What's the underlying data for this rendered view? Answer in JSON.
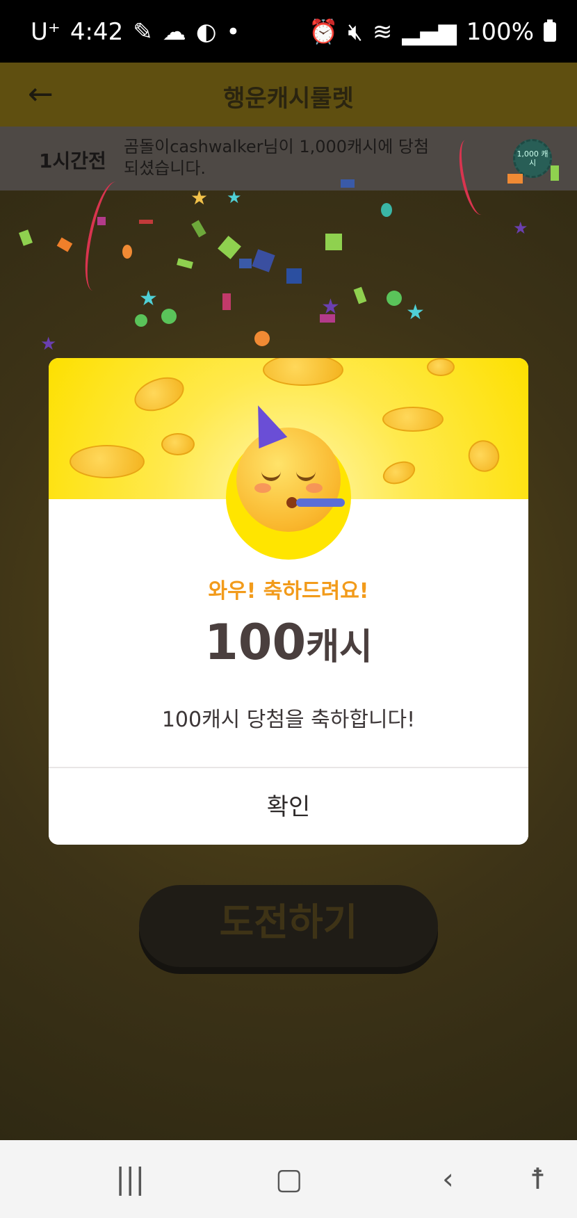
{
  "status_bar": {
    "carrier": "U⁺",
    "time": "4:42",
    "battery_percent": "100%"
  },
  "app_bar": {
    "title": "행운캐시룰렛"
  },
  "ticker": {
    "time_ago": "1시간전",
    "message": "곰돌이cashwalker님이 1,000캐시에 당첨되셨습니다.",
    "coin_label": "1,000 캐시"
  },
  "modal": {
    "congrats": "와우! 축하드려요!",
    "amount_number": "100",
    "amount_unit": "캐시",
    "description": "100캐시 당첨을 축하합니다!",
    "confirm_label": "확인"
  },
  "challenge_button": {
    "label": "도전하기"
  },
  "colors": {
    "accent_yellow": "#fde000",
    "congrats_orange": "#f29b1b",
    "amount_text": "#4a3f3e"
  }
}
